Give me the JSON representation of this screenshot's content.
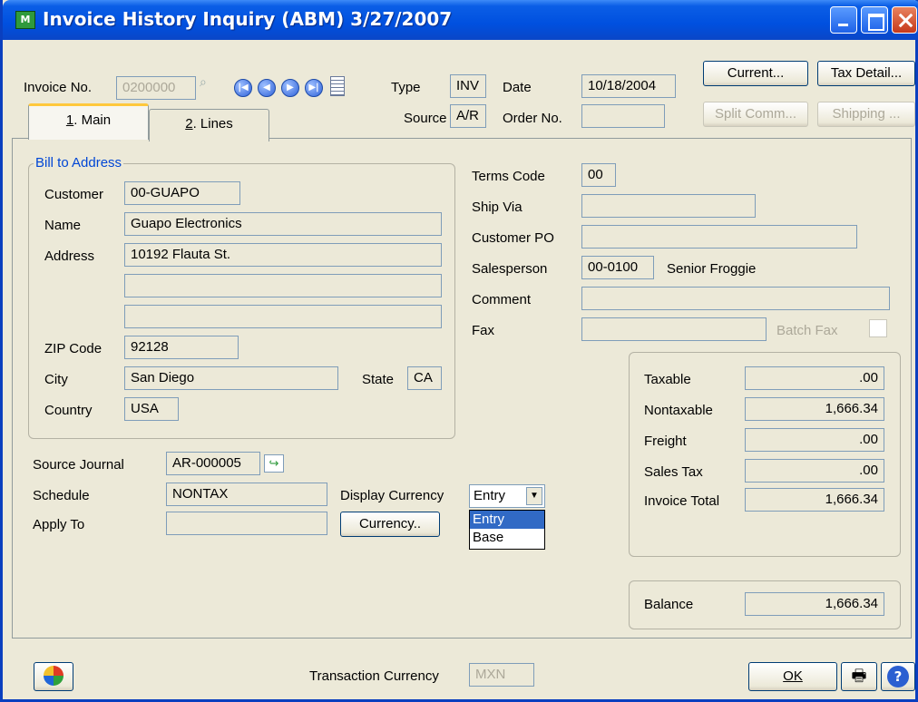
{
  "window": {
    "title": "Invoice History Inquiry (ABM) 3/27/2007",
    "app_icon_text": "M"
  },
  "header": {
    "invoice_no_label": "Invoice No.",
    "invoice_no": "0200000",
    "type_label": "Type",
    "type": "INV",
    "date_label": "Date",
    "date": "10/18/2004",
    "source_label": "Source",
    "source": "A/R",
    "order_no_label": "Order No.",
    "order_no": "",
    "buttons": {
      "current": "Current...",
      "tax_detail": "Tax Detail...",
      "split_comm": "Split Comm...",
      "shipping": "Shipping ..."
    }
  },
  "tabs": [
    {
      "num": "1",
      "label": ". Main"
    },
    {
      "num": "2",
      "label": ". Lines"
    }
  ],
  "bill_to": {
    "legend": "Bill to Address",
    "customer_label": "Customer",
    "customer": "00-GUAPO",
    "name_label": "Name",
    "name": "Guapo Electronics",
    "address_label": "Address",
    "address1": "10192 Flauta St.",
    "address2": "",
    "address3": "",
    "zip_label": "ZIP Code",
    "zip": "92128",
    "city_label": "City",
    "city": "San Diego",
    "state_label": "State",
    "state": "CA",
    "country_label": "Country",
    "country": "USA"
  },
  "right_info": {
    "terms_code_label": "Terms Code",
    "terms_code": "00",
    "ship_via_label": "Ship Via",
    "ship_via": "",
    "customer_po_label": "Customer PO",
    "customer_po": "",
    "salesperson_label": "Salesperson",
    "salesperson": "00-0100",
    "salesperson_name": "Senior Froggie",
    "comment_label": "Comment",
    "comment": "",
    "fax_label": "Fax",
    "fax": "",
    "batch_fax_label": "Batch Fax"
  },
  "lower_left": {
    "source_journal_label": "Source Journal",
    "source_journal": "AR-000005",
    "schedule_label": "Schedule",
    "schedule": "NONTAX",
    "apply_to_label": "Apply To",
    "apply_to": "",
    "display_currency_label": "Display Currency",
    "display_currency": "Entry",
    "currency_button": "Currency..",
    "currency_options": [
      "Entry",
      "Base"
    ]
  },
  "totals": {
    "taxable_label": "Taxable",
    "taxable": ".00",
    "nontaxable_label": "Nontaxable",
    "nontaxable": "1,666.34",
    "freight_label": "Freight",
    "freight": ".00",
    "sales_tax_label": "Sales Tax",
    "sales_tax": ".00",
    "invoice_total_label": "Invoice Total",
    "invoice_total": "1,666.34",
    "balance_label": "Balance",
    "balance": "1,666.34"
  },
  "footer": {
    "transaction_currency_label": "Transaction Currency",
    "transaction_currency": "MXN",
    "ok_button": "OK"
  }
}
